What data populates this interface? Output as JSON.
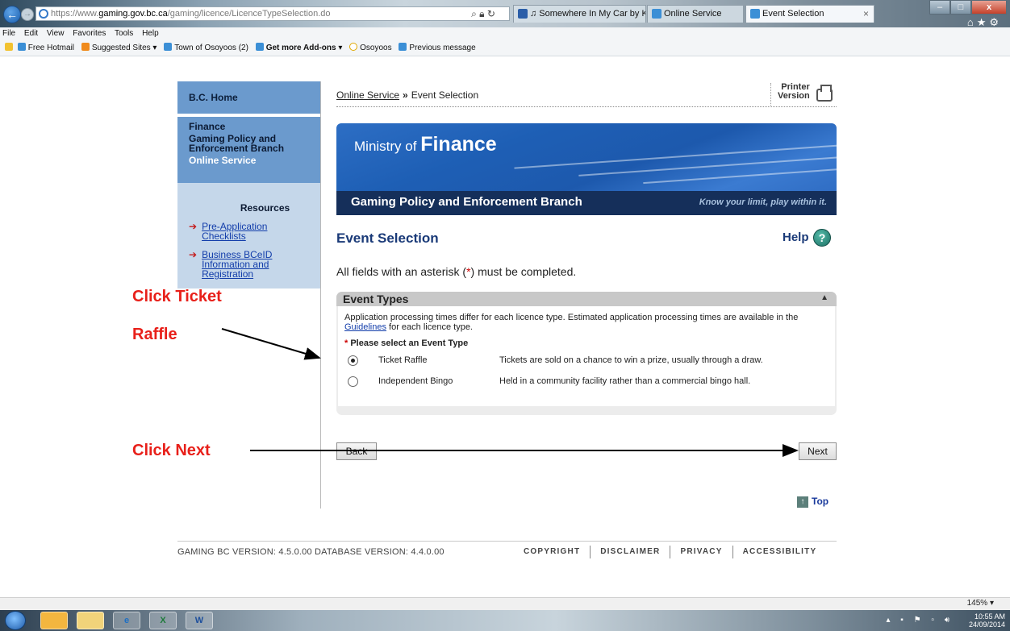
{
  "browser": {
    "url_prefix": "https://www.",
    "url_domain": "gaming.gov.bc.ca",
    "url_path": "/gaming/licence/LicenceTypeSelection.do",
    "tabs": [
      {
        "label": "♫ Somewhere In My Car by Ke..."
      },
      {
        "label": "Online Service"
      },
      {
        "label": "Event Selection"
      }
    ],
    "menu": [
      "File",
      "Edit",
      "View",
      "Favorites",
      "Tools",
      "Help"
    ],
    "favorites": [
      {
        "label": "Free Hotmail",
        "bold": false
      },
      {
        "label": "Suggested Sites ▾",
        "bold": false
      },
      {
        "label": "Town of Osoyoos (2)",
        "bold": false
      },
      {
        "label": "Get more Add-ons ▾",
        "bold": true
      },
      {
        "label": "Osoyoos",
        "bold": false
      },
      {
        "label": "Previous message",
        "bold": false
      }
    ]
  },
  "nav": {
    "home": "B.C. Home",
    "finance": "Finance",
    "gaming_line1": "Gaming Policy and",
    "gaming_line2": "Enforcement Branch",
    "online_service": "Online Service",
    "resources_title": "Resources",
    "links": [
      {
        "line1": "Pre-Application",
        "line2": "Checklists"
      },
      {
        "line1": "Business BCeID",
        "line2": "Information and",
        "line3": "Registration"
      }
    ]
  },
  "breadcrumb": {
    "parent": "Online Service",
    "separator": "»",
    "current": "Event Selection"
  },
  "printer": {
    "line1": "Printer",
    "line2": "Version"
  },
  "banner": {
    "ministry_prefix": "Ministry of",
    "ministry_name": "Finance",
    "branch": "Gaming Policy and Enforcement Branch",
    "tagline": "Know your limit, play within it."
  },
  "page": {
    "title": "Event Selection",
    "help_label": "Help",
    "required_prefix": "All fields with an asterisk (",
    "required_asterisk": "*",
    "required_suffix": ") must be completed."
  },
  "panel": {
    "title": "Event Types",
    "desc_1": "Application processing times differ for each licence type. Estimated application processing times are available in the ",
    "desc_link": "Guidelines",
    "desc_2": " for each licence type.",
    "select_label": "Please select an Event Type",
    "options": [
      {
        "name": "Ticket Raffle",
        "desc": "Tickets are sold on a chance to win a prize, usually through a draw.",
        "selected": true
      },
      {
        "name": "Independent Bingo",
        "desc": "Held in a community facility rather than a commercial bingo hall.",
        "selected": false
      }
    ]
  },
  "buttons": {
    "back": "Back",
    "next": "Next"
  },
  "top_link": "Top",
  "footer": {
    "version_text": "GAMING BC VERSION: 4.5.0.00 DATABASE VERSION: 4.4.0.00",
    "links": [
      "COPYRIGHT",
      "DISCLAIMER",
      "PRIVACY",
      "ACCESSIBILITY"
    ]
  },
  "annotations": {
    "raffle_line1": "Click Ticket",
    "raffle_line2": "Raffle",
    "next": "Click Next",
    "color": "#e8201a"
  },
  "status": {
    "zoom": "145% ▾"
  },
  "taskbar": {
    "time": "10:55 AM",
    "date": "24/09/2014"
  }
}
